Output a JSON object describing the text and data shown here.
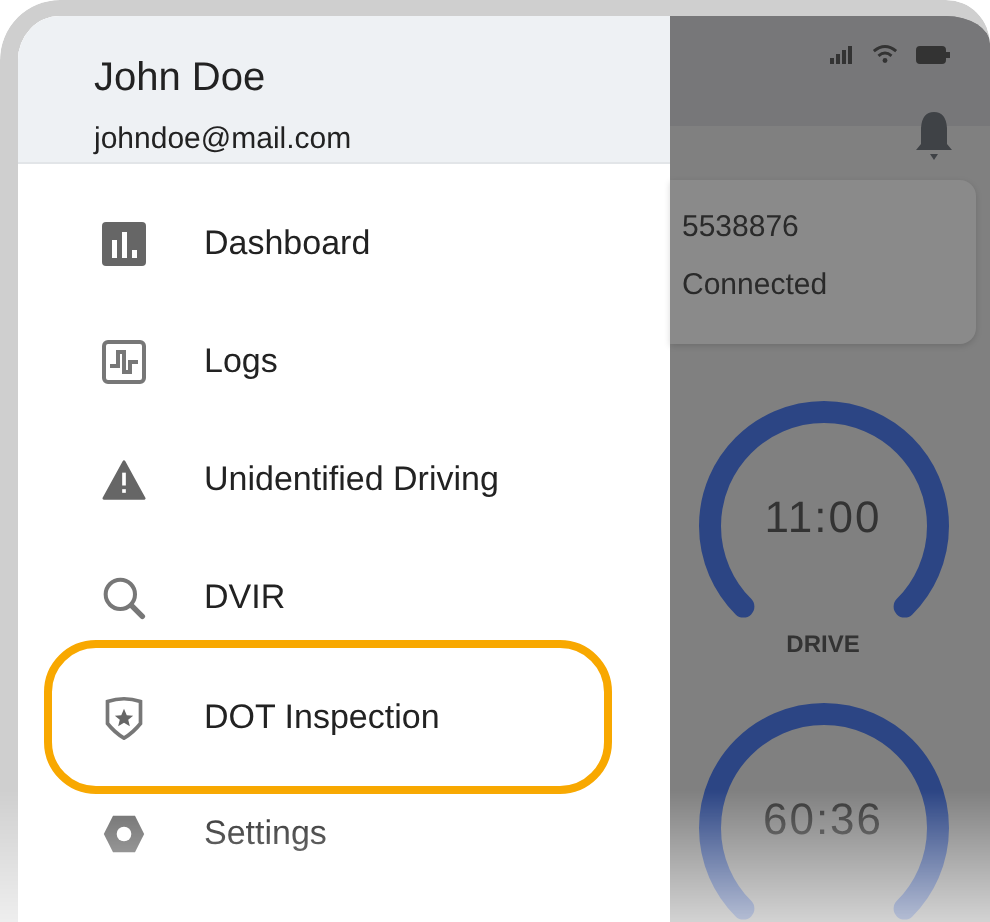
{
  "user": {
    "name": "John Doe",
    "email": "johndoe@mail.com"
  },
  "menu": [
    {
      "label": "Dashboard",
      "kind": "chart",
      "highlighted": false
    },
    {
      "label": "Logs",
      "kind": "logs",
      "highlighted": false
    },
    {
      "label": "Unidentified Driving",
      "kind": "warning",
      "highlighted": false
    },
    {
      "label": "DVIR",
      "kind": "search",
      "highlighted": false
    },
    {
      "label": "DOT Inspection",
      "kind": "shield",
      "highlighted": true
    },
    {
      "label": "Settings",
      "kind": "settings",
      "highlighted": false
    }
  ],
  "background_screen": {
    "device_id": "5538876",
    "connection": "Connected",
    "gauges": [
      {
        "time": "11:00",
        "label": "DRIVE"
      },
      {
        "time": "60:36"
      }
    ]
  }
}
